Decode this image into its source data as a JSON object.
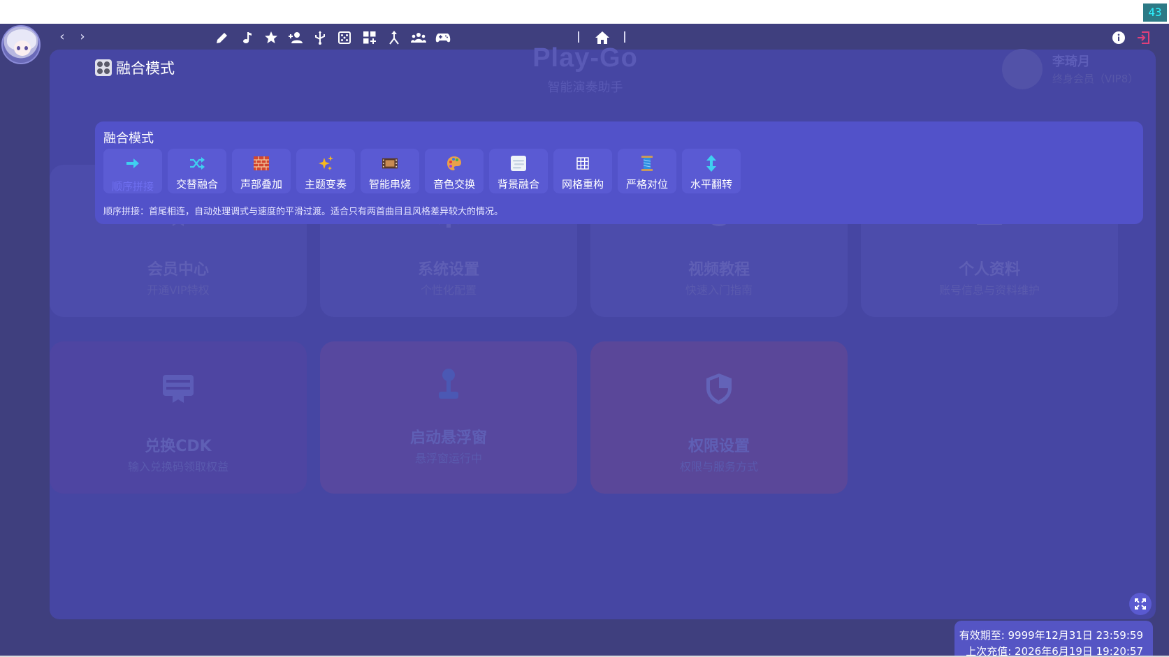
{
  "fps": "43",
  "toolbar": {
    "back_label": "‹",
    "forward_label": "›",
    "tools": [
      "pencil-icon",
      "music-note-icon",
      "star-icon",
      "person-add-icon",
      "usb-icon",
      "dice-icon",
      "grid-add-icon",
      "merge-icon",
      "group-icon",
      "gamepad-icon"
    ],
    "home": "home-icon",
    "right": [
      "info-icon",
      "logout-icon"
    ]
  },
  "sidebar": {
    "items": [
      "list-icon",
      "hub-icon",
      "disc-icon",
      "sparkle-icon",
      "chip-icon",
      "fork-icon",
      "info-icon",
      "checklist-icon",
      "trend-icon",
      "task-icon",
      "multi-trend-icon",
      "clipboard-clock-icon"
    ],
    "active_index": 1
  },
  "page": {
    "title": "融合模式"
  },
  "brand": {
    "title": "Play-Go",
    "subtitle": "智能演奏助手"
  },
  "user": {
    "name": "李琦月",
    "level": "终身会员（VIP8）"
  },
  "cards": [
    {
      "title": "会员中心",
      "subtitle": "开通VIP特权",
      "icon": "card-membership-icon"
    },
    {
      "title": "系统设置",
      "subtitle": "个性化配置",
      "icon": "gear-icon"
    },
    {
      "title": "视频教程",
      "subtitle": "快速入门指南",
      "icon": "play-disc-icon"
    },
    {
      "title": "个人资料",
      "subtitle": "账号信息与资料维护",
      "icon": "person-icon"
    },
    {
      "title": "兑换CDK",
      "subtitle": "输入兑换码领取权益",
      "icon": "card-redeem-icon"
    },
    {
      "title": "启动悬浮窗",
      "subtitle": "悬浮窗运行中",
      "icon": "joystick-icon"
    },
    {
      "title": "权限设置",
      "subtitle": "权限与服务方式",
      "icon": "shield-icon"
    }
  ],
  "fusion": {
    "heading": "融合模式",
    "modes": [
      {
        "label": "顺序拼接",
        "icon": "➡"
      },
      {
        "label": "交替融合",
        "icon": "⤨"
      },
      {
        "label": "声部叠加",
        "icon": "🧱"
      },
      {
        "label": "主题变奏",
        "icon": "✨"
      },
      {
        "label": "智能串烧",
        "icon": "🎞"
      },
      {
        "label": "音色交换",
        "icon": "🎨"
      },
      {
        "label": "背景融合",
        "icon": "🌫"
      },
      {
        "label": "网格重构",
        "icon": "▦"
      },
      {
        "label": "严格对位",
        "icon": "🧵"
      },
      {
        "label": "水平翻转",
        "icon": "↕"
      }
    ],
    "selected_index": 0,
    "description": "顺序拼接：首尾相连，自动处理调式与速度的平滑过渡。适合只有两首曲目且风格差异较大的情况。"
  },
  "validity": {
    "expires": "有效期至: 9999年12月31日 23:59:59",
    "last_recharge": "上次充值: 2026年6月19日 19:20:57"
  },
  "colors": {
    "background": "#3f3f7e",
    "panel": "#4646a3",
    "overlay": "#5252c9",
    "accent": "#6f6ff0",
    "logout": "#e0407a"
  }
}
